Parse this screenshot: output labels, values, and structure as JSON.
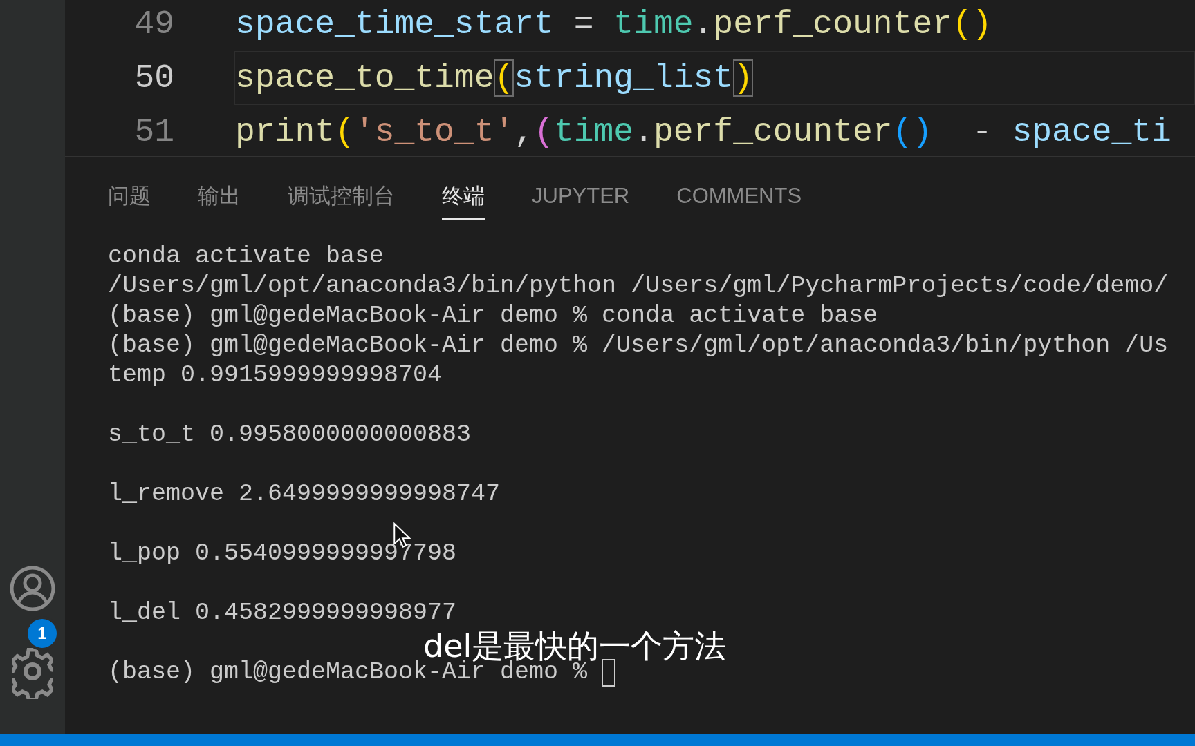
{
  "editor": {
    "lines": [
      {
        "number": "49",
        "current": false,
        "tokens": [
          {
            "text": "space_time_start",
            "kind": "variable"
          },
          {
            "text": " = ",
            "kind": "operator"
          },
          {
            "text": "time",
            "kind": "module"
          },
          {
            "text": ".",
            "kind": "operator"
          },
          {
            "text": "perf_counter",
            "kind": "function"
          },
          {
            "text": "()",
            "kind": "paren-gold"
          }
        ]
      },
      {
        "number": "50",
        "current": true,
        "tokens": [
          {
            "text": "space_to_time",
            "kind": "function"
          },
          {
            "text": "(",
            "kind": "paren-matched"
          },
          {
            "text": "string_list",
            "kind": "variable"
          },
          {
            "text": ")",
            "kind": "paren-matched"
          }
        ]
      },
      {
        "number": "51",
        "current": false,
        "tokens": [
          {
            "text": "print",
            "kind": "function"
          },
          {
            "text": "(",
            "kind": "paren-gold"
          },
          {
            "text": "'s_to_t'",
            "kind": "string"
          },
          {
            "text": ",",
            "kind": "operator"
          },
          {
            "text": "(",
            "kind": "paren-pink"
          },
          {
            "text": "time",
            "kind": "module"
          },
          {
            "text": ".",
            "kind": "operator"
          },
          {
            "text": "perf_counter",
            "kind": "function"
          },
          {
            "text": "()",
            "kind": "paren-blue"
          },
          {
            "text": "  - ",
            "kind": "operator"
          },
          {
            "text": "space_ti",
            "kind": "variable"
          }
        ]
      }
    ]
  },
  "panel": {
    "tabs": [
      {
        "label": "问题",
        "selected": false
      },
      {
        "label": "输出",
        "selected": false
      },
      {
        "label": "调试控制台",
        "selected": false
      },
      {
        "label": "终端",
        "selected": true
      },
      {
        "label": "JUPYTER",
        "selected": false
      },
      {
        "label": "COMMENTS",
        "selected": false
      }
    ],
    "terminal_blocks": [
      [
        "conda activate base",
        "/Users/gml/opt/anaconda3/bin/python /Users/gml/PycharmProjects/code/demo/",
        "(base) gml@gedeMacBook-Air demo % conda activate base",
        "(base) gml@gedeMacBook-Air demo % /Users/gml/opt/anaconda3/bin/python /Us",
        "temp 0.9915999999998704"
      ],
      [
        "s_to_t 0.9958000000000883"
      ],
      [
        "l_remove 2.6499999999998747"
      ],
      [
        "l_pop 0.5540999999997798"
      ],
      [
        "l_del 0.4582999999998977"
      ],
      [
        "(base) gml@gedeMacBook-Air demo %"
      ]
    ]
  },
  "activity_bar": {
    "accounts_badge": "1"
  },
  "subtitle": "del是最快的一个方法"
}
